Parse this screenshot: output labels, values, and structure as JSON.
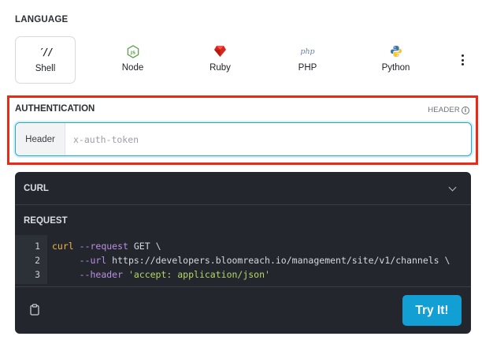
{
  "language": {
    "heading": "LANGUAGE",
    "items": [
      {
        "label": "Shell",
        "icon": "shell-icon",
        "active": true
      },
      {
        "label": "Node",
        "icon": "nodejs-icon",
        "active": false
      },
      {
        "label": "Ruby",
        "icon": "ruby-icon",
        "active": false
      },
      {
        "label": "PHP",
        "icon": "php-icon",
        "active": false
      },
      {
        "label": "Python",
        "icon": "python-icon",
        "active": false
      }
    ],
    "shell_glyph": "′//",
    "php_glyph": "php",
    "more_icon": "kebab-menu-icon"
  },
  "authentication": {
    "title": "AUTHENTICATION",
    "header_tag": "HEADER",
    "addon_label": "Header",
    "input_placeholder": "x-auth-token",
    "input_value": "",
    "highlight_color": "#ea2a17",
    "focus_color": "#26a7d6"
  },
  "code": {
    "client_label": "CURL",
    "request_label": "REQUEST",
    "line_numbers": [
      "1",
      "2",
      "3"
    ],
    "lines": [
      {
        "cmd": "curl",
        "flag": "--request",
        "rest": " GET \\"
      },
      {
        "indent": "     ",
        "flag": "--url",
        "rest": " https://developers.bloomreach.io/management/site/v1/channels \\"
      },
      {
        "indent": "     ",
        "flag": "--header",
        "str": " 'accept: application/json'"
      }
    ],
    "copy_icon": "clipboard-icon",
    "try_label": "Try It!",
    "button_color": "#119fd4",
    "panel_color": "#23272d"
  }
}
